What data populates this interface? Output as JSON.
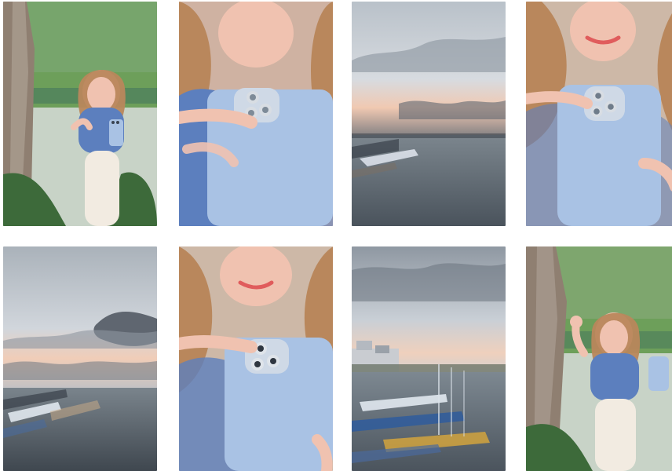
{
  "gallery": {
    "tiles": [
      {
        "id": "t1",
        "subject": "woman-with-phone-under-tree"
      },
      {
        "id": "t2",
        "subject": "hand-holding-phone-closeup"
      },
      {
        "id": "t3",
        "subject": "harbor-sky-sunset"
      },
      {
        "id": "t4",
        "subject": "woman-holding-phone-closeup"
      },
      {
        "id": "t5",
        "subject": "harbor-cloudy-sky"
      },
      {
        "id": "t6",
        "subject": "woman-holding-phone-closeup-2"
      },
      {
        "id": "t7",
        "subject": "harbor-boats-town"
      },
      {
        "id": "t8",
        "subject": "woman-waving-under-tree"
      }
    ]
  },
  "palette": {
    "sky": "#c9d0d6",
    "cloud": "#6d7480",
    "sea": "#6f7a83",
    "phone": "#a9c2e4",
    "skin": "#f0c2b0",
    "hair": "#b9875c",
    "shirt": "#5c7fbe",
    "pants": "#f2ebe1",
    "foliage": "#4f8a3d",
    "trunk": "#8a7a6a"
  }
}
